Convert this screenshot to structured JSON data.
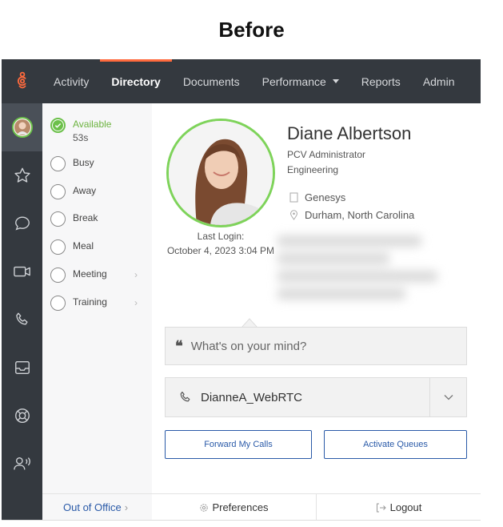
{
  "heading": "Before",
  "nav": {
    "items": [
      {
        "label": "Activity"
      },
      {
        "label": "Directory"
      },
      {
        "label": "Documents"
      },
      {
        "label": "Performance"
      },
      {
        "label": "Reports"
      },
      {
        "label": "Admin"
      }
    ],
    "active_index": 1
  },
  "rail": {
    "icons": [
      "avatar-status",
      "star-icon",
      "chat-icon",
      "video-icon",
      "phone-icon",
      "inbox-icon",
      "lifebuoy-icon",
      "contacts-icon"
    ]
  },
  "status": {
    "available": {
      "label": "Available",
      "duration": "53s"
    },
    "options": [
      {
        "label": "Busy"
      },
      {
        "label": "Away"
      },
      {
        "label": "Break"
      },
      {
        "label": "Meal"
      },
      {
        "label": "Meeting"
      },
      {
        "label": "Training"
      }
    ],
    "out_of_office": "Out of Office",
    "out_of_office_chevron": "›"
  },
  "profile": {
    "name": "Diane Albertson",
    "title": "PCV Administrator",
    "department": "Engineering",
    "company": "Genesys",
    "location": "Durham, North Carolina",
    "last_login_label": "Last Login:",
    "last_login_value": "October 4, 2023 3:04 PM"
  },
  "mind": {
    "quote_glyph": "❝",
    "placeholder": "What's on your mind?"
  },
  "phone": {
    "station": "DianneA_WebRTC"
  },
  "buttons": {
    "forward": "Forward My Calls",
    "queues": "Activate Queues"
  },
  "bottom": {
    "preferences": "Preferences",
    "logout": "Logout"
  },
  "colors": {
    "nav_bg": "#34393f",
    "accent_orange": "#ff6a3d",
    "status_green": "#6cc04a",
    "link_blue": "#2a5aa8"
  }
}
